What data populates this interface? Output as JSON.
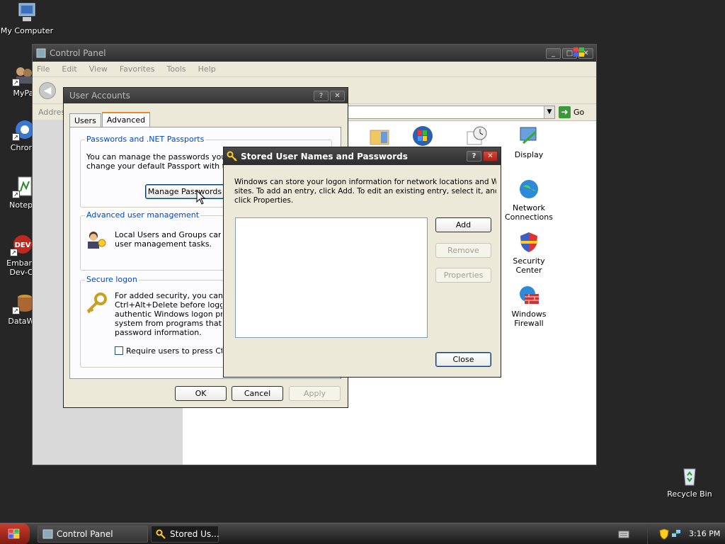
{
  "desktop": {
    "icons": [
      {
        "label": "My Computer"
      },
      {
        "label": "MyPa"
      },
      {
        "label": "Chrom"
      },
      {
        "label": "Notepa"
      },
      {
        "label": "Embarc Dev-C"
      },
      {
        "label": "DataWa"
      },
      {
        "label": "Recycle Bin"
      }
    ]
  },
  "control_panel": {
    "title": "Control Panel",
    "menu": [
      "File",
      "Edit",
      "View",
      "Favorites",
      "Tools",
      "Help"
    ],
    "address_label": "Addres",
    "go_label": "Go",
    "icons": [
      {
        "label": "Display"
      },
      {
        "label": "Network Connections"
      },
      {
        "label": "Security Center"
      },
      {
        "label": "Windows Firewall"
      }
    ]
  },
  "user_accounts": {
    "title": "User Accounts",
    "tabs": [
      "Users",
      "Advanced"
    ],
    "passwords_group": {
      "title": "Passwords and .NET Passports",
      "text_line1": "You can manage the passwords you hav",
      "text_line2": "change your default Passport with the .",
      "button": "Manage Passwords"
    },
    "advanced_group": {
      "title": "Advanced user management",
      "text_line1": "Local Users and Groups can be",
      "text_line2": "user management tasks."
    },
    "secure_group": {
      "title": "Secure logon",
      "text_line1": "For added security, you can rec",
      "text_line2": "Ctrl+Alt+Delete before logging",
      "text_line3": "authentic Windows logon promp",
      "text_line4": "system from programs that mim",
      "text_line5": "password information.",
      "checkbox": "Require users to press Ctrl+"
    },
    "ok": "OK",
    "cancel": "Cancel",
    "apply": "Apply"
  },
  "stored_passwords": {
    "title": "Stored User Names and Passwords",
    "description_line1": "Windows can store your logon information for network locations and Web",
    "description_line2": "sites. To add an entry, click Add. To edit an existing entry, select it, and then",
    "description_line3": "click Properties.",
    "add": "Add",
    "remove": "Remove",
    "properties": "Properties",
    "close": "Close"
  },
  "window_buttons": {
    "help": "?",
    "close": "✕",
    "minimize": "_",
    "maximize": "□"
  },
  "taskbar": {
    "items": [
      "Control Panel",
      "Stored Us..."
    ],
    "clock": "3:16 PM"
  }
}
